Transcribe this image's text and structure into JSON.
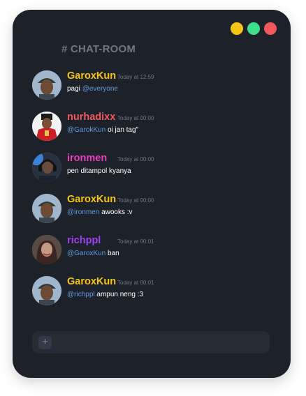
{
  "window": {
    "controls": [
      {
        "name": "minimize",
        "color": "#f6c416"
      },
      {
        "name": "maximize",
        "color": "#3ddf8a"
      },
      {
        "name": "close",
        "color": "#f0585c"
      }
    ]
  },
  "channel": {
    "title": "# CHAT-ROOM"
  },
  "messages": [
    {
      "user": "GaroxKun",
      "user_color": "#f6c416",
      "time": "Today at 12:59",
      "mention": "@everyone",
      "text": "pagi",
      "mention_first": false,
      "avatar": "man-with-cap"
    },
    {
      "user": "nurhadixx",
      "user_color": "#f0585c",
      "time": "Today at 00:00",
      "mention": "@GarokKun",
      "text": "oi jan tag\"",
      "mention_first": true,
      "avatar": "man-in-red-uniform"
    },
    {
      "user": "ironmen",
      "user_color": "#e83fc0",
      "time": "Today at 00:00",
      "mention": "",
      "text": "pen ditampol kyanya",
      "mention_first": true,
      "avatar": "man-with-headphones"
    },
    {
      "user": "GaroxKun",
      "user_color": "#f6c416",
      "time": "Today at 00:00",
      "mention": "@ironmen",
      "text": "awooks :v",
      "mention_first": true,
      "avatar": "man-with-cap"
    },
    {
      "user": "richppl",
      "user_color": "#a040ee",
      "time": "Today at 00:01",
      "mention": "@GaroxKun",
      "text": "ban",
      "mention_first": true,
      "avatar": "woman-portrait"
    },
    {
      "user": "GaroxKun",
      "user_color": "#f6c416",
      "time": "Today at 00:01",
      "mention": "@richppl",
      "text": "ampun neng :3",
      "mention_first": true,
      "avatar": "man-with-cap"
    }
  ],
  "composer": {
    "add_icon": "plus-icon",
    "add_symbol": "+",
    "placeholder": ""
  }
}
